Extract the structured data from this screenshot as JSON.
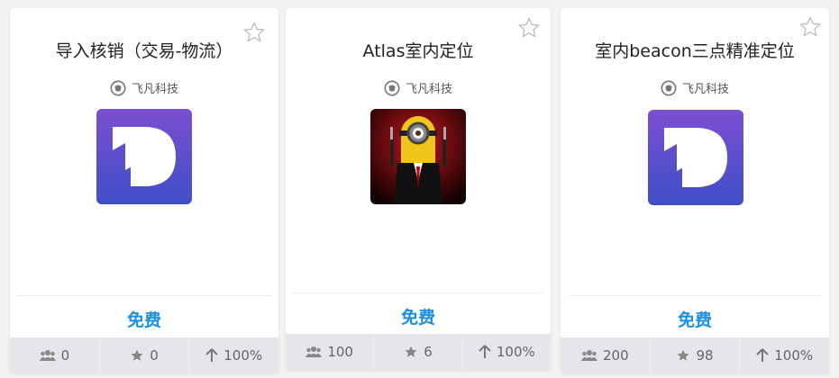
{
  "cards": [
    {
      "title": "导入核销（交易-物流）",
      "vendor": "飞凡科技",
      "logo": "dash-d-logo",
      "price": "免费",
      "users": "0",
      "stars": "0",
      "uptime": "100%"
    },
    {
      "title": "Atlas室内定位",
      "vendor": "飞凡科技",
      "logo": "minion-agent-logo",
      "price": "免费",
      "users": "100",
      "stars": "6",
      "uptime": "100%"
    },
    {
      "title": "室内beacon三点精准定位",
      "vendor": "飞凡科技",
      "logo": "dash-d-logo",
      "price": "免费",
      "users": "200",
      "stars": "98",
      "uptime": "100%"
    }
  ],
  "colors": {
    "price": "#1a8fe6",
    "logo_gradient_top": "#7b4fd1",
    "logo_gradient_bottom": "#3f4fc8"
  }
}
